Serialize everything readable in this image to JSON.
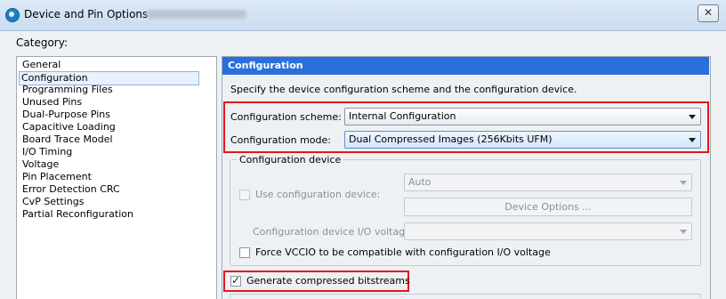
{
  "window": {
    "title": "Device and Pin Options – ",
    "close_glyph": "✕"
  },
  "category_label": "Category:",
  "categories": [
    "General",
    "Configuration",
    "Programming Files",
    "Unused Pins",
    "Dual-Purpose Pins",
    "Capacitive Loading",
    "Board Trace Model",
    "I/O Timing",
    "Voltage",
    "Pin Placement",
    "Error Detection CRC",
    "CvP Settings",
    "Partial Reconfiguration"
  ],
  "selected_category": "Configuration",
  "panel": {
    "header": "Configuration",
    "description": "Specify the device configuration scheme and the configuration device.",
    "scheme_label": "Configuration scheme:",
    "scheme_value": "Internal Configuration",
    "mode_label": "Configuration mode:",
    "mode_value": "Dual Compressed Images (256Kbits UFM)",
    "config_device_group": {
      "title": "Configuration device",
      "use_device_label": "Use configuration device:",
      "use_device_checked": false,
      "device_value": "Auto",
      "device_options_button": "Device Options ...",
      "io_voltage_label": "Configuration device I/O voltage:",
      "io_voltage_value": "",
      "force_vccio_label": "Force VCCIO to be compatible with configuration I/O voltage",
      "force_vccio_checked": false
    },
    "generate_compressed_label": "Generate compressed bitstreams",
    "generate_compressed_checked": true
  },
  "colors": {
    "header_bg": "#2a6fdb",
    "highlight_red": "#e8141c"
  }
}
